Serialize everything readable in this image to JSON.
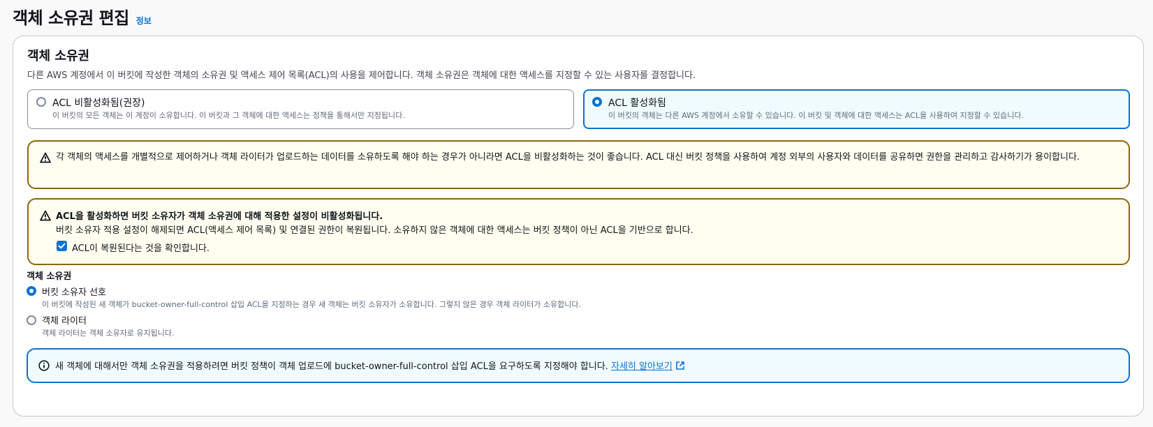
{
  "header": {
    "title": "객체 소유권 편집",
    "info_link": "정보"
  },
  "section": {
    "title": "객체 소유권",
    "description": "다른 AWS 계정에서 이 버킷에 작성한 객체의 소유권 및 액세스 제어 목록(ACL)의 사용을 제어합니다. 객체 소유권은 객체에 대한 액세스를 지정할 수 있는 사용자를 결정합니다."
  },
  "acl_tiles": [
    {
      "label": "ACL 비활성화됨(권장)",
      "description": "이 버킷의 모든 객체는 이 계정이 소유합니다. 이 버킷과 그 객체에 대한 액세스는 정책을 통해서만 지정됩니다.",
      "selected": false
    },
    {
      "label": "ACL 활성화됨",
      "description": "이 버킷의 객체는 다른 AWS 계정에서 소유할 수 있습니다. 이 버킷 및 객체에 대한 액세스는 ACL을 사용하여 지정할 수 있습니다.",
      "selected": true
    }
  ],
  "warning1": {
    "text": "각 객체의 액세스를 개별적으로 제어하거나 객체 라이터가 업로드하는 데이터를 소유하도록 해야 하는 경우가 아니라면 ACL을 비활성화하는 것이 좋습니다. ACL 대신 버킷 정책을 사용하여 계정 외부의 사용자와 데이터를 공유하면 권한을 관리하고 감사하기가 용이합니다."
  },
  "warning2": {
    "title": "ACL을 활성화하면 버킷 소유자가 객체 소유권에 대해 적용한 설정이 비활성화됩니다.",
    "body": "버킷 소유자 적용 설정이 해제되면 ACL(액세스 제어 목록) 및 연결된 권한이 복원됩니다. 소유하지 않은 객체에 대한 액세스는 버킷 정책이 아닌 ACL을 기반으로 합니다.",
    "checkbox_label": "ACL이 복원된다는 것을 확인합니다.",
    "checked": true
  },
  "ownership": {
    "label": "객체 소유권",
    "options": [
      {
        "label": "버킷 소유자 선호",
        "description": "이 버킷에 작성된 새 객체가 bucket-owner-full-control 삽입 ACL을 지정하는 경우 새 객체는 버킷 소유자가 소유합니다. 그렇지 않은 경우 객체 라이터가 소유합니다.",
        "selected": true
      },
      {
        "label": "객체 라이터",
        "description": "객체 라이터는 객체 소유자로 유지됩니다.",
        "selected": false
      }
    ]
  },
  "info_alert": {
    "text": "새 객체에 대해서만 객체 소유권을 적용하려면 버킷 정책이 객체 업로드에 bucket-owner-full-control 삽입 ACL을 요구하도록 지정해야 합니다.",
    "link_label": "자세히 알아보기"
  },
  "colors": {
    "accent": "#0972d3",
    "warning_border": "#8d6605",
    "warning_bg": "#fffef0",
    "info_bg": "#f0fbff"
  },
  "icons": [
    "warning-icon",
    "info-icon",
    "external-link-icon",
    "check-icon"
  ]
}
